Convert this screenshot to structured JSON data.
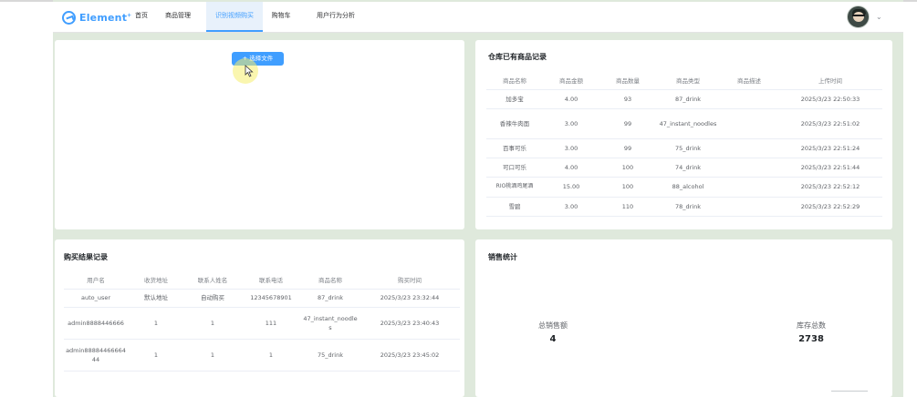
{
  "nav": {
    "logo_text": "Element",
    "items": [
      {
        "label": "首页"
      },
      {
        "label": "商品管理"
      },
      {
        "label": "识别视频购买"
      },
      {
        "label": "购物车"
      },
      {
        "label": "用户行为分析"
      }
    ],
    "active_index": 2,
    "caret": "⌄"
  },
  "upload": {
    "button_label": "+ 选择文件"
  },
  "inventory": {
    "title": "仓库已有商品记录",
    "headers": [
      "商品名称",
      "商品金额",
      "商品数量",
      "商品类型",
      "商品描述",
      "上传时间"
    ],
    "rows": [
      [
        "加多宝",
        "4.00",
        "93",
        "87_drink",
        "",
        "2025/3/23 22:50:33"
      ],
      [
        "香辣牛肉面",
        "3.00",
        "99",
        "47_instant_noodles",
        "",
        "2025/3/23 22:51:02"
      ],
      [
        "百事可乐",
        "3.00",
        "99",
        "75_drink",
        "",
        "2025/3/23 22:51:24"
      ],
      [
        "可口可乐",
        "4.00",
        "100",
        "74_drink",
        "",
        "2025/3/23 22:51:44"
      ],
      [
        "RIO桃酒鸡尾酒",
        "15.00",
        "100",
        "88_alcohol",
        "",
        "2025/3/23 22:52:12"
      ],
      [
        "雪碧",
        "3.00",
        "110",
        "78_drink",
        "",
        "2025/3/23 22:52:29"
      ]
    ]
  },
  "purchases": {
    "title": "购买结果记录",
    "headers": [
      "用户名",
      "收货地址",
      "联系人姓名",
      "联系电话",
      "商品名称",
      "购买时间"
    ],
    "rows": [
      [
        "auto_user",
        "默认地址",
        "自动购买",
        "12345678901",
        "87_drink",
        "2025/3/23 23:32:44"
      ],
      [
        "admin8888446666",
        "1",
        "1",
        "111",
        "47_instant_noodles",
        "2025/3/23 23:40:43"
      ],
      [
        "admin8888446666444",
        "1",
        "1",
        "1",
        "75_drink",
        "2025/3/23 23:45:02"
      ]
    ]
  },
  "sales": {
    "title": "销售统计",
    "total_sales_label": "总销售额",
    "total_sales_value": "4",
    "total_stock_label": "库存总数",
    "total_stock_value": "2738"
  }
}
